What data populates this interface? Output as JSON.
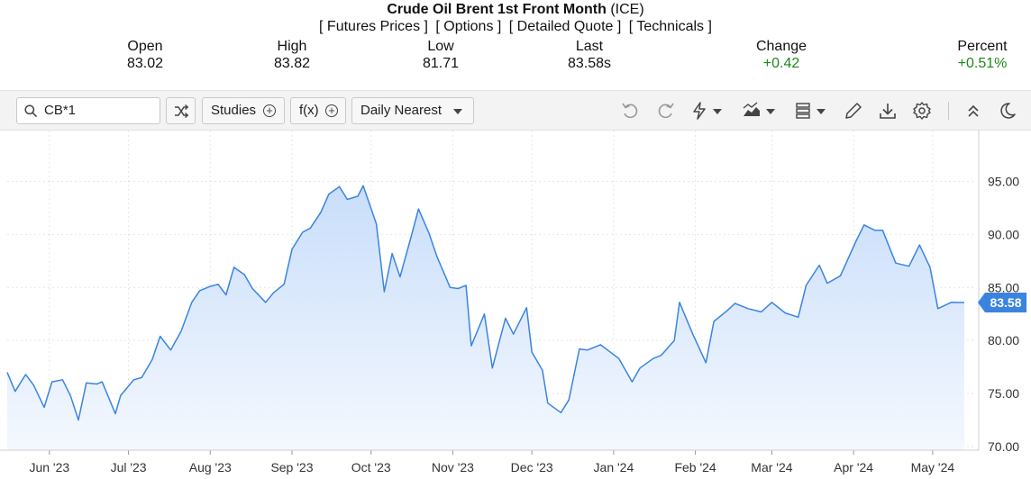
{
  "header": {
    "title_bold": "Crude Oil Brent 1st Front Month",
    "title_exchange": "(ICE)",
    "links": [
      "[ Futures Prices ]",
      "[ Options ]",
      "[ Detailed Quote ]",
      "[ Technicals ]"
    ],
    "stats": [
      {
        "label": "Open",
        "value": "83.02"
      },
      {
        "label": "High",
        "value": "83.82"
      },
      {
        "label": "Low",
        "value": "81.71"
      },
      {
        "label": "Last",
        "value": "83.58s"
      },
      {
        "label": "Change",
        "value": "+0.42"
      },
      {
        "label": "Percent",
        "value": "+0.51%"
      }
    ]
  },
  "toolbar": {
    "symbol_value": "CB*1",
    "studies_label": "Studies",
    "fx_label": "f(x)",
    "period_label": "Daily Nearest",
    "icons": [
      "search-icon",
      "shuffle-icon",
      "plus-circle-icon",
      "undo-icon",
      "redo-icon",
      "lightning-icon",
      "chart-type-icon",
      "layout-icon",
      "pencil-icon",
      "download-icon",
      "gear-icon",
      "collapse-icon",
      "theme-moon-icon"
    ]
  },
  "colors": {
    "line": "#3a84e0",
    "area_top": "#c9defb",
    "area_bottom": "#f4f8fe",
    "badge": "#3a84e0",
    "positive": "#1b8a1b"
  },
  "chart_data": {
    "type": "area",
    "x_labels": [
      "Jun '23",
      "Jul '23",
      "Aug '23",
      "Sep '23",
      "Oct '23",
      "Nov '23",
      "Dec '23",
      "Jan '24",
      "Feb '24",
      "Mar '24",
      "Apr '24",
      "May '24"
    ],
    "y_ticks": [
      "95.00",
      "90.00",
      "85.00",
      "80.00",
      "75.00",
      "70.00"
    ],
    "ylim": [
      70,
      97.5
    ],
    "last_value_label": "83.58",
    "series": [
      {
        "x": [
          "2023-05-16",
          "2023-05-19",
          "2023-05-23",
          "2023-05-26",
          "2023-05-30",
          "2023-06-02",
          "2023-06-06",
          "2023-06-09",
          "2023-06-12",
          "2023-06-15",
          "2023-06-19",
          "2023-06-21",
          "2023-06-26",
          "2023-06-28",
          "2023-07-03",
          "2023-07-06",
          "2023-07-10",
          "2023-07-13",
          "2023-07-17",
          "2023-07-21",
          "2023-07-25",
          "2023-07-28",
          "2023-08-01",
          "2023-08-04",
          "2023-08-07",
          "2023-08-10",
          "2023-08-14",
          "2023-08-17",
          "2023-08-22",
          "2023-08-25",
          "2023-08-29",
          "2023-09-01",
          "2023-09-05",
          "2023-09-08",
          "2023-09-12",
          "2023-09-15",
          "2023-09-19",
          "2023-09-22",
          "2023-09-26",
          "2023-09-28",
          "2023-10-03",
          "2023-10-06",
          "2023-10-09",
          "2023-10-12",
          "2023-10-16",
          "2023-10-19",
          "2023-10-23",
          "2023-10-26",
          "2023-10-31",
          "2023-11-03",
          "2023-11-06",
          "2023-11-08",
          "2023-11-13",
          "2023-11-16",
          "2023-11-21",
          "2023-11-24",
          "2023-11-29",
          "2023-12-01",
          "2023-12-05",
          "2023-12-07",
          "2023-12-12",
          "2023-12-15",
          "2023-12-19",
          "2023-12-22",
          "2023-12-27",
          "2024-01-03",
          "2024-01-08",
          "2024-01-11",
          "2024-01-16",
          "2024-01-19",
          "2024-01-24",
          "2024-01-26",
          "2024-01-31",
          "2024-02-05",
          "2024-02-08",
          "2024-02-13",
          "2024-02-16",
          "2024-02-21",
          "2024-02-26",
          "2024-03-01",
          "2024-03-06",
          "2024-03-11",
          "2024-03-14",
          "2024-03-19",
          "2024-03-22",
          "2024-03-27",
          "2024-04-02",
          "2024-04-05",
          "2024-04-09",
          "2024-04-12",
          "2024-04-17",
          "2024-04-22",
          "2024-04-26",
          "2024-04-30",
          "2024-05-03",
          "2024-05-08",
          "2024-05-13"
        ],
        "y": [
          77.0,
          75.2,
          76.8,
          75.8,
          73.7,
          76.1,
          76.3,
          74.8,
          72.5,
          76.0,
          75.9,
          76.1,
          73.1,
          74.8,
          76.3,
          76.5,
          78.2,
          80.4,
          79.1,
          80.9,
          83.6,
          84.7,
          85.1,
          85.3,
          84.3,
          86.9,
          86.2,
          84.9,
          83.6,
          84.5,
          85.3,
          88.6,
          90.2,
          90.6,
          92.1,
          93.8,
          94.5,
          93.3,
          93.6,
          94.6,
          91.0,
          84.6,
          88.2,
          86.0,
          89.6,
          92.4,
          90.1,
          87.9,
          85.0,
          84.9,
          85.2,
          79.5,
          82.5,
          77.4,
          82.1,
          80.6,
          83.1,
          78.9,
          77.2,
          74.1,
          73.2,
          74.4,
          79.2,
          79.1,
          79.6,
          78.3,
          76.1,
          77.4,
          78.3,
          78.6,
          80.0,
          83.6,
          80.6,
          77.9,
          81.8,
          82.8,
          83.5,
          83.0,
          82.7,
          83.6,
          82.6,
          82.2,
          85.2,
          87.1,
          85.4,
          86.1,
          89.4,
          90.9,
          90.4,
          90.4,
          87.3,
          87.0,
          89.0,
          86.9,
          83.0,
          83.6,
          83.58
        ]
      }
    ]
  }
}
